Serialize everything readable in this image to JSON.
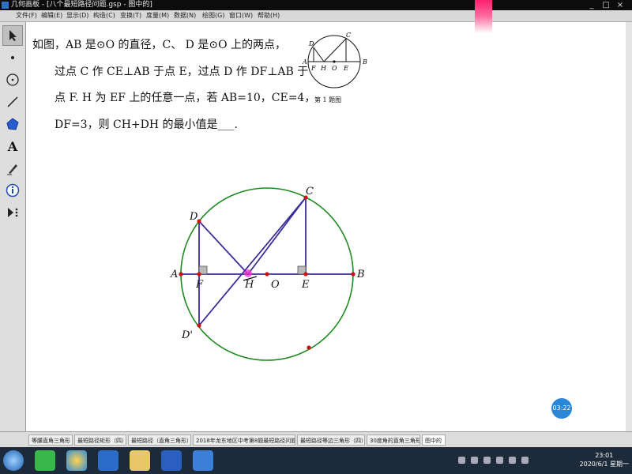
{
  "window": {
    "title": "几何画板 - [八个最短路径问题.gsp - 图中的]",
    "controls": [
      "_",
      "□",
      "×"
    ]
  },
  "menu": [
    "文件(F)",
    "编辑(E)",
    "显示(D)",
    "构造(C)",
    "变换(T)",
    "度量(M)",
    "数据(N)",
    "绘图(G)",
    "窗口(W)",
    "帮助(H)"
  ],
  "tools": [
    "arrow-icon",
    "point-icon",
    "compass-icon",
    "straightedge-icon",
    "polygon-icon",
    "text-icon",
    "marker-icon",
    "info-icon",
    "custom-tool-icon"
  ],
  "problem": {
    "lines": [
      "如图，AB 是⊙O 的直径，C、 D 是⊙O 上的两点，",
      "过点 C 作 CE⊥AB 于点 E，过点 D 作 DF⊥AB 于",
      "点 F.  H 为 EF 上的任意一点，若 AB=10，CE=4，",
      "DF=3，则 CH+DH 的最小值是___."
    ],
    "caption": "第 1 题图"
  },
  "small_figure_labels": {
    "D": "D",
    "C": "C",
    "A": "A",
    "B": "B",
    "F": "F",
    "H": "H",
    "O": "O",
    "E": "E"
  },
  "big_figure_labels": {
    "A": "A",
    "B": "B",
    "C": "C",
    "D": "D",
    "D2": "D'",
    "E": "E",
    "F": "F",
    "H": "H",
    "O": "O"
  },
  "timer": "03:22",
  "page_tabs": [
    "等腰直角三角形",
    "最短路径矩形（四）",
    "最短路径（直角三角形）",
    "2018年龙东地区中考第8题最短路径问题",
    "最短路径等边三角形（四）",
    "30度角的直角三角形",
    "图中的"
  ],
  "active_tab": "图中的",
  "clock": {
    "time": "23:01",
    "date": "2020/6/1 星期一"
  },
  "colors": {
    "circle": "#1f8a1f",
    "segment": "#3a2e9a",
    "point": "#cc1010",
    "highlight": "#ff2fd0"
  }
}
